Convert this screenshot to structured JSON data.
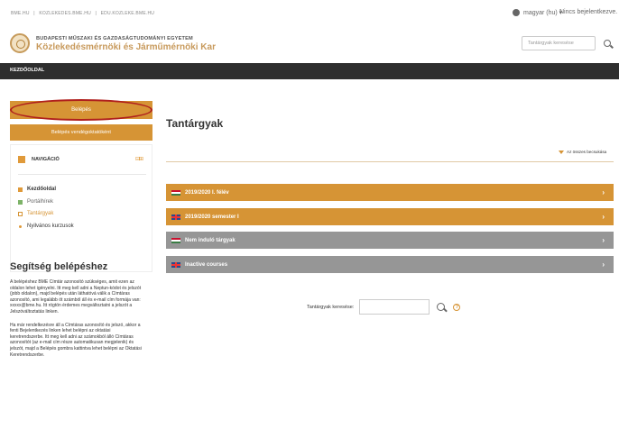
{
  "topbar": {
    "links": [
      "BME.HU",
      "|",
      "KOZLEKEDES.BME.HU",
      "|",
      "EDU.KOZLEKE.BME.HU"
    ],
    "language": "magyar (hu) ▾",
    "login_status": "Nincs bejelentkezve."
  },
  "header": {
    "university": "BUDAPESTI MŰSZAKI ÉS GAZDASÁGTUDOMÁNYI EGYETEM",
    "faculty": "Közlekedésmérnöki és Járműmérnöki Kar",
    "search_placeholder": "Tantárgyak keresése"
  },
  "navbar": {
    "home": "KEZDŐOLDAL"
  },
  "sidebar": {
    "login_button": "Belépés",
    "guest_button": "Belépés vendégoktatóként",
    "nav_title": "NAVIGÁCIÓ",
    "nav_controls": "⊟⊞",
    "nav_items": [
      {
        "label": "Kezdőoldal"
      },
      {
        "label": "Portálhírek"
      },
      {
        "label": "Tantárgyak"
      },
      {
        "label": "Nyilvános kurzusok"
      }
    ],
    "help_title": "Segítség belépéshez",
    "help_p1": "A belépéshez BME Címtár azonosító szükséges, amit ezen az oldalon lehet igényelni. Itt meg kell adni a Neptun-kódot és jelszót (jobb oldalon), majd belépés után láthatóvá válik a Címtáras azonosító, ami legalább öt számból áll és e-mail cím formája van: xxxxx@bme.hu. Itt rögtön érdemes megváltoztatni a jelszót a Jelszóváltoztatás linken.",
    "help_p2": "Ha már rendelkezésre áll a Címtáras azonosító és jelszó, akkor a fenti Bejelentkezés linken lehet belépni az oktatási keretrendszerbe. Itt meg kell adni az számokból álló Címtáras azonosítót (az e-mail cím része automatikusan megjelenik) és jelszót, majd a Belépés gombra kattintva lehet belépni az Oktatási Keretrendszerbe."
  },
  "main": {
    "title": "Tantárgyak",
    "collapse_all": "Az összes becsukása",
    "categories": [
      {
        "label": "2019/2020 I. félév",
        "flag": "hu",
        "color": "#d69435"
      },
      {
        "label": "2019/2020 semester I",
        "flag": "en",
        "color": "#d69435"
      },
      {
        "label": "Nem induló tárgyak",
        "flag": "hu",
        "color": "#969696"
      },
      {
        "label": "Inactive courses",
        "flag": "en",
        "color": "#969696"
      }
    ],
    "search_label": "Tantárgyak keresése:",
    "chevron": "›"
  },
  "colors": {
    "accent": "#d69435",
    "dark_bar": "#2e2e2e",
    "highlight_ring": "#b0201d"
  }
}
